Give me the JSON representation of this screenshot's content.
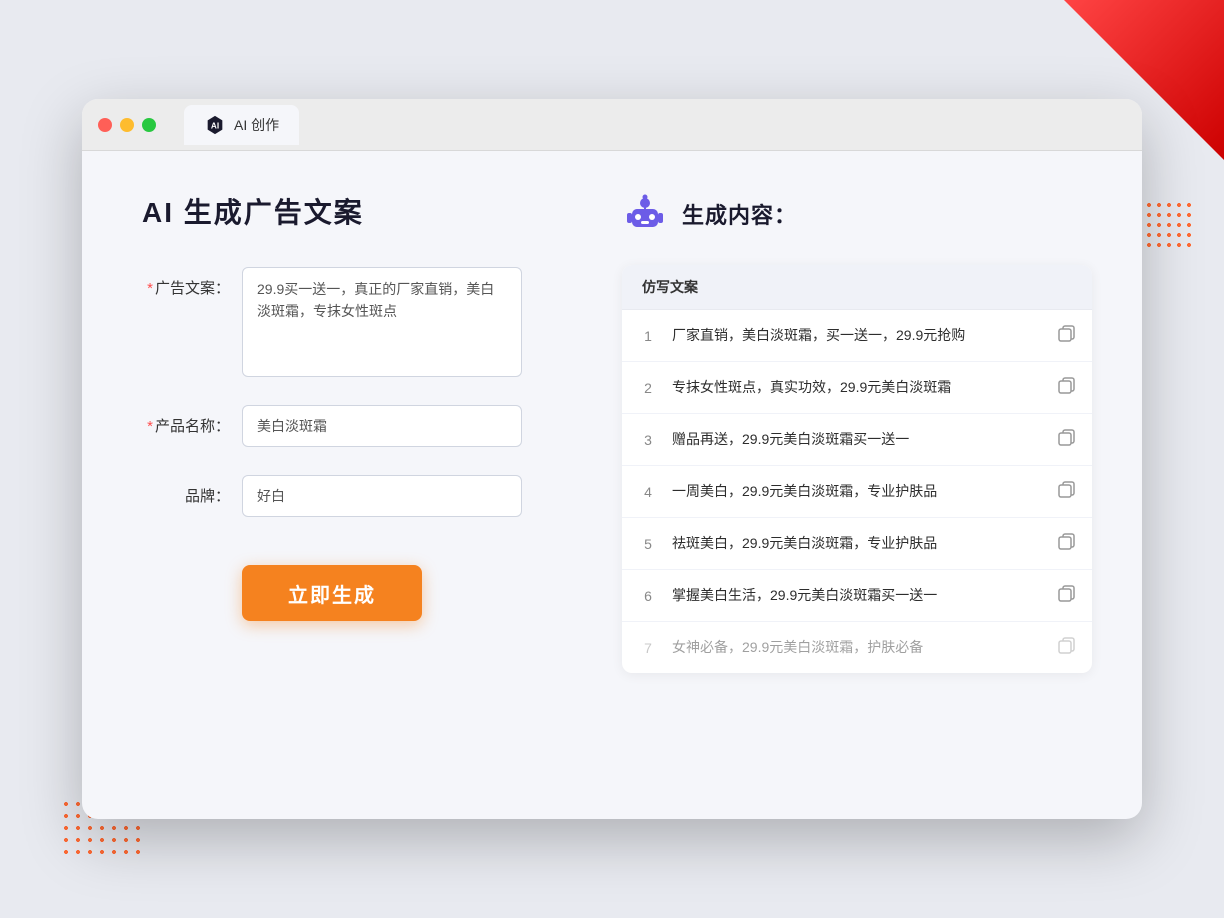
{
  "window": {
    "tab_title": "AI 创作",
    "tab_icon_label": "AI"
  },
  "left_panel": {
    "page_title": "AI 生成广告文案",
    "fields": [
      {
        "label": "广告文案：",
        "required": true,
        "type": "textarea",
        "value": "29.9买一送一，真正的厂家直销，美白淡斑霜，专抹女性斑点",
        "placeholder": ""
      },
      {
        "label": "产品名称：",
        "required": true,
        "type": "input",
        "value": "美白淡斑霜",
        "placeholder": ""
      },
      {
        "label": "品牌：",
        "required": false,
        "type": "input",
        "value": "好白",
        "placeholder": ""
      }
    ],
    "button_label": "立即生成"
  },
  "right_panel": {
    "title": "生成内容：",
    "table_header": "仿写文案",
    "results": [
      {
        "id": 1,
        "text": "厂家直销，美白淡斑霜，买一送一，29.9元抢购",
        "faded": false
      },
      {
        "id": 2,
        "text": "专抹女性斑点，真实功效，29.9元美白淡斑霜",
        "faded": false
      },
      {
        "id": 3,
        "text": "赠品再送，29.9元美白淡斑霜买一送一",
        "faded": false
      },
      {
        "id": 4,
        "text": "一周美白，29.9元美白淡斑霜，专业护肤品",
        "faded": false
      },
      {
        "id": 5,
        "text": "祛斑美白，29.9元美白淡斑霜，专业护肤品",
        "faded": false
      },
      {
        "id": 6,
        "text": "掌握美白生活，29.9元美白淡斑霜买一送一",
        "faded": false
      },
      {
        "id": 7,
        "text": "女神必备，29.9元美白淡斑霜，护肤必备",
        "faded": true
      }
    ]
  },
  "colors": {
    "accent": "#f5821f",
    "required": "#ff4d4d",
    "text_primary": "#1a1a2e",
    "text_secondary": "#888"
  }
}
